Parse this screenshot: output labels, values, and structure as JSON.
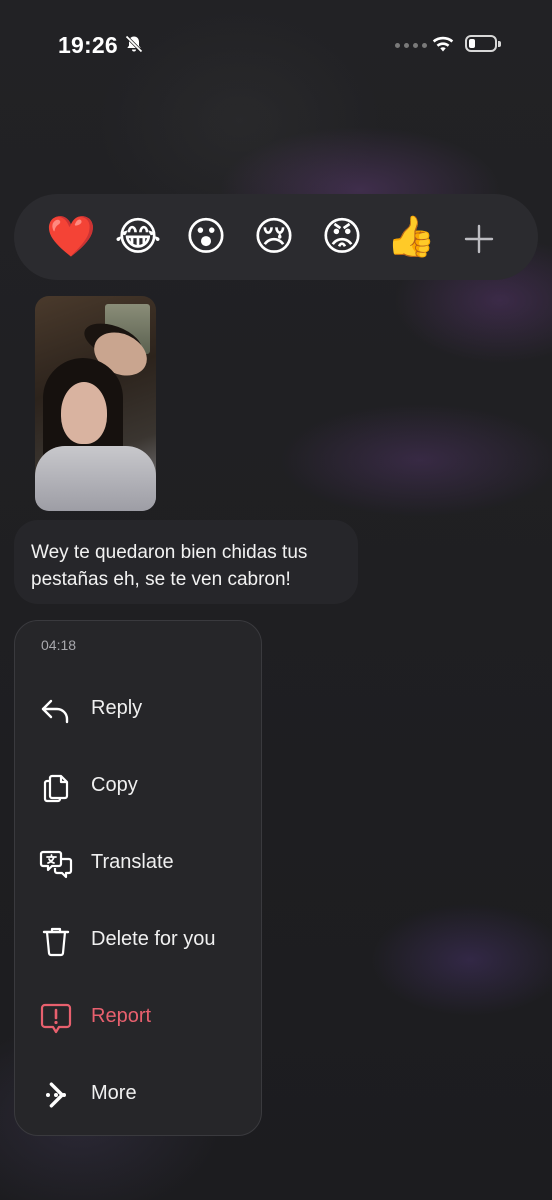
{
  "status_bar": {
    "time": "19:26"
  },
  "reactions": {
    "emojis": [
      "❤️",
      "😂",
      "😮",
      "😢",
      "😡",
      "👍"
    ]
  },
  "message": {
    "text": "Wey te quedaron bien chidas tus pestañas eh, se te ven cabron!"
  },
  "menu": {
    "timestamp": "04:18",
    "items": [
      {
        "label": "Reply",
        "icon": "reply-icon"
      },
      {
        "label": "Copy",
        "icon": "copy-icon"
      },
      {
        "label": "Translate",
        "icon": "translate-icon"
      },
      {
        "label": "Delete for you",
        "icon": "trash-icon"
      },
      {
        "label": "Report",
        "icon": "report-icon",
        "color": "#e8606e"
      },
      {
        "label": "More",
        "icon": "more-icon"
      }
    ]
  }
}
